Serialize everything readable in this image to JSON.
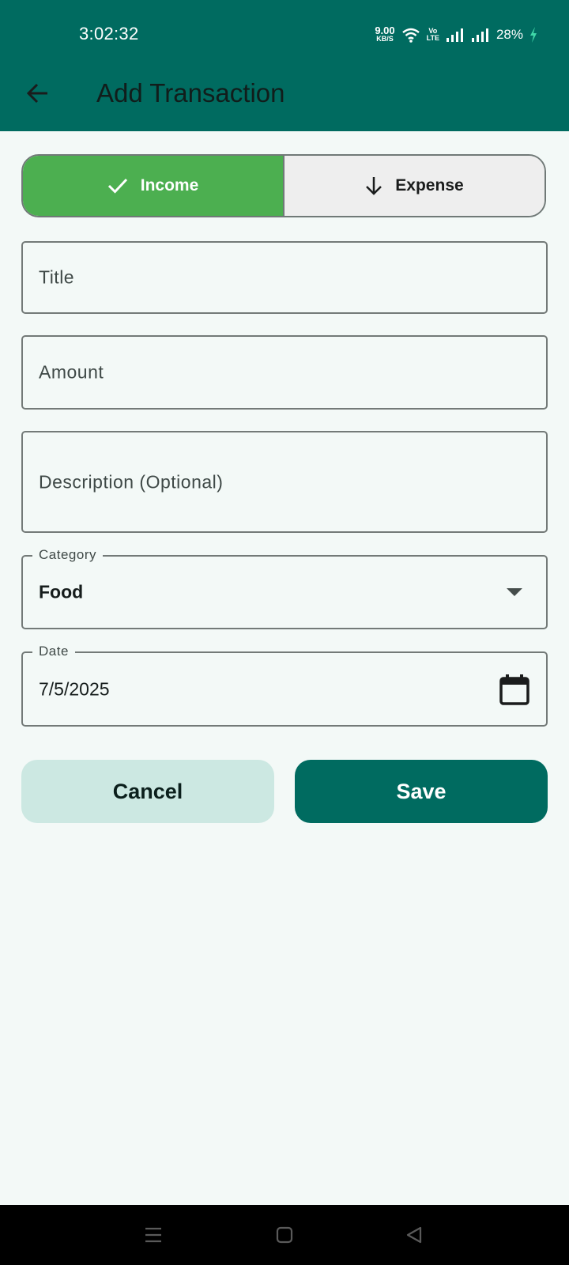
{
  "status_bar": {
    "time": "3:02:32",
    "net_speed_value": "9.00",
    "net_speed_unit": "KB/S",
    "volte_top": "Vo",
    "volte_bottom": "LTE",
    "battery": "28%",
    "icons": [
      "wifi-icon",
      "signal-icon",
      "battery-charging-icon"
    ]
  },
  "app_bar": {
    "title": "Add Transaction",
    "back_icon": "arrow-back-icon"
  },
  "type_toggle": {
    "income_label": "Income",
    "expense_label": "Expense",
    "selected": "Income",
    "income_icon": "check-icon",
    "expense_icon": "arrow-down-icon"
  },
  "form": {
    "title_placeholder": "Title",
    "amount_placeholder": "Amount",
    "description_placeholder": "Description (Optional)",
    "category_label": "Category",
    "category_value": "Food",
    "date_label": "Date",
    "date_value": "7/5/2025",
    "date_icon": "calendar-icon"
  },
  "actions": {
    "cancel_label": "Cancel",
    "save_label": "Save"
  },
  "nav_bar": {
    "icons": [
      "menu-icon",
      "home-icon",
      "back-icon"
    ]
  },
  "colors": {
    "primary": "#006b60",
    "income_green": "#4caf50",
    "background": "#f3f9f7",
    "cancel_bg": "#cce8e2"
  }
}
